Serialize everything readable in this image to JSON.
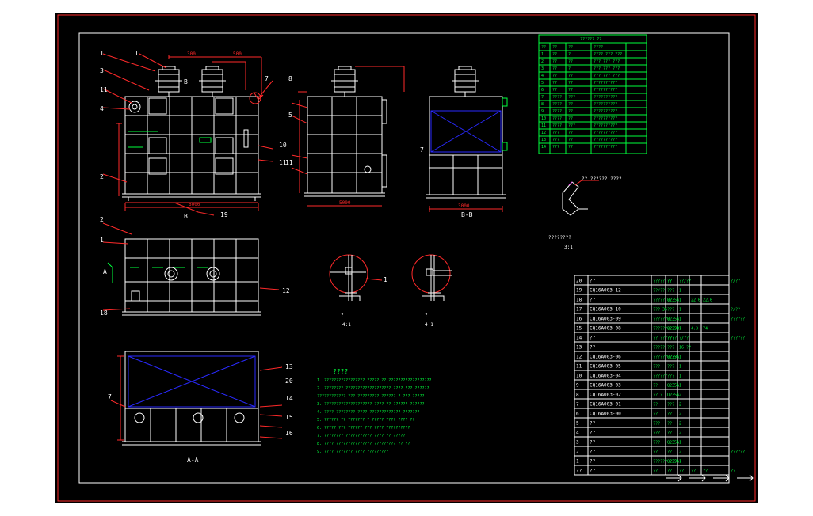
{
  "views": {
    "main_section_label": "B",
    "side_section_label": "B-B",
    "plan_section_label": "A",
    "bottom_section_label": "A-A",
    "detail_label": "3:1",
    "detail_title": "????????",
    "detail_welds_label": "?? ?????? ????",
    "detail_a_label": "?",
    "detail_a_scale": "4:1",
    "detail_b_label": "?",
    "detail_b_scale": "4:1",
    "detail_b_scale_2": "4:1"
  },
  "dimensions": {
    "top_1": "300",
    "top_2": "500",
    "side_height": "200",
    "width_1": "300",
    "width_2": "3000",
    "overall": "6000",
    "side_overall": "5000",
    "bb_overall": "3000"
  },
  "callouts": {
    "main": [
      "1",
      "3",
      "11",
      "4",
      "2",
      "7",
      "B",
      "9",
      "10",
      "11",
      "5",
      "7"
    ],
    "plan": [
      "2",
      "1",
      "A",
      "18",
      "12"
    ],
    "bottom": [
      "13",
      "20",
      "14",
      "15",
      "16",
      "7"
    ],
    "side": [
      "8",
      "5",
      "11",
      "7"
    ],
    "main_labels_set": [
      "6",
      "5",
      "11",
      "4",
      "3",
      "7",
      "7",
      "B",
      "10",
      "11",
      "B",
      "19"
    ],
    "t_label": "T",
    "b_tag": "B",
    "main_b": "B"
  },
  "upper_table": {
    "title": "?????? ??",
    "header": [
      "??",
      "??",
      "??",
      "????"
    ],
    "rows": [
      [
        "1",
        "??",
        "?",
        "???? ??? ???"
      ],
      [
        "2",
        "??",
        "??",
        "??? ??? ???"
      ],
      [
        "3",
        "??",
        "?",
        "??? ??? ???"
      ],
      [
        "4",
        "??",
        "??",
        "??? ??? ???"
      ],
      [
        "5",
        "??",
        "??",
        "??????????"
      ],
      [
        "6",
        "??",
        "??",
        "??????????"
      ],
      [
        "7",
        "????",
        "???",
        "??????????"
      ],
      [
        "8",
        "????",
        "??",
        "??????????"
      ],
      [
        "9",
        "????",
        "??",
        "??????????"
      ],
      [
        "10",
        "????",
        "??",
        "??????????"
      ],
      [
        "11",
        "????",
        "???",
        "??????????"
      ],
      [
        "12",
        "???",
        "??",
        "??????????"
      ],
      [
        "13",
        "???",
        "??",
        "??????????"
      ],
      [
        "14",
        "???",
        "??",
        "??????????"
      ]
    ]
  },
  "notes": {
    "title": "????",
    "lines": [
      "1. ????????????????? ????? ?? ??????????????????",
      "2. ???????? ??????????????????? ???? ??? ??????",
      "???????????? ??? ????????? ?????? ? ??? ?????",
      "3. ???????????????????? ???? ?? ?????? ??????",
      "4. ???? ???????? ???? ????????????? ???????",
      "5. ?????? ?? ??????? ? ????? ???? ???? ??",
      "6. ????? ??? ?????? ??? ???? ??????????",
      "7. ???????? ??????????? ???? ?? ?????",
      "8. ???? ??????????????? ????????? ?? ??",
      "9. ???? ??????? ???? ?????????"
    ]
  },
  "parts_table": {
    "rows": [
      [
        "20",
        "??",
        "????? ??",
        "??",
        "??/??",
        "",
        "",
        "?/??"
      ],
      [
        "19",
        "CQ16A003-12",
        "??/??",
        "???",
        "1",
        "",
        "",
        ""
      ],
      [
        "18",
        "??",
        "????? ??",
        "Q235A",
        "1",
        "22.6",
        "22.6",
        ""
      ],
      [
        "17",
        "CQ16A003-10",
        "??? 36",
        "???",
        "1",
        "",
        "",
        "?/??"
      ],
      [
        "16",
        "CQ16A003-09",
        "???????",
        "Q235A",
        "1",
        "",
        "",
        "??????"
      ],
      [
        "15",
        "CQ16A003-08",
        "????????????",
        "Q235A",
        "1",
        "4.3",
        "74",
        ""
      ],
      [
        "14",
        "??",
        "?? ???????",
        "???",
        "?/??",
        "",
        "",
        "??????"
      ],
      [
        "13",
        "??",
        "?????",
        "???",
        "16 ??",
        "",
        "",
        ""
      ],
      [
        "12",
        "CQ16A003-06",
        "??????????",
        "Q235A",
        "1",
        "",
        "",
        ""
      ],
      [
        "11",
        "CQ16A003-05",
        "???",
        "???",
        "1",
        "",
        "",
        ""
      ],
      [
        "10",
        "CQ16A003-04",
        "??????",
        "???",
        "1",
        "",
        "",
        ""
      ],
      [
        "9",
        "CQ16A003-03",
        "??",
        "Q235A",
        "1",
        "",
        "",
        ""
      ],
      [
        "8",
        "CQ16A003-02",
        "?? ?",
        "Q235A",
        "2",
        "",
        "",
        ""
      ],
      [
        "7",
        "CQ16A003-01",
        "??",
        "???",
        "2",
        "",
        "",
        ""
      ],
      [
        "6",
        "CQ16A003-00",
        "??",
        "??",
        "2",
        "",
        "",
        ""
      ],
      [
        "5",
        "??",
        "???",
        "??",
        "2",
        "",
        "",
        ""
      ],
      [
        "4",
        "??",
        "???",
        "??",
        "2",
        "",
        "",
        ""
      ],
      [
        "3",
        "??",
        "???",
        "Q235A",
        "1",
        "",
        "",
        ""
      ],
      [
        "2",
        "??",
        "??",
        "??",
        "2",
        "",
        "",
        "??????"
      ],
      [
        "1",
        "??",
        "?????? ??? ?",
        "Q235A",
        "1",
        "",
        "",
        ""
      ],
      [
        "??",
        "??",
        "??",
        "??",
        "??",
        "??",
        "??",
        "??"
      ]
    ]
  },
  "colors": {
    "frame": "#ff2a2a",
    "line": "#ffffff",
    "annotation": "#00ff3c",
    "hatch": "#2a2aff"
  }
}
